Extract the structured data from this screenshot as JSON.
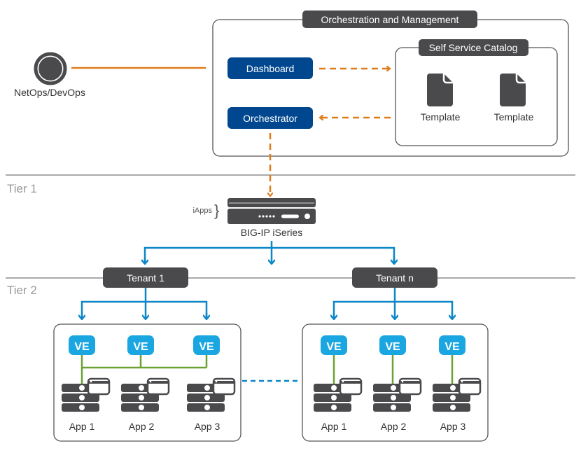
{
  "actor": {
    "label": "NetOps/DevOps",
    "icon": "user-icon"
  },
  "orchestration": {
    "title": "Orchestration and Management",
    "dashboard_label": "Dashboard",
    "orchestrator_label": "Orchestrator",
    "catalog": {
      "title": "Self Service Catalog",
      "templates": [
        {
          "label": "Template",
          "icon": "document-icon"
        },
        {
          "label": "Template",
          "icon": "document-icon"
        }
      ]
    }
  },
  "tiers": {
    "tier1": "Tier 1",
    "tier2": "Tier 2"
  },
  "device": {
    "label": "BIG-IP iSeries",
    "iapps_label": "iApps"
  },
  "tenants": [
    {
      "label": "Tenant 1",
      "ve_label": "VE",
      "apps": [
        "App 1",
        "App 2",
        "App 3"
      ],
      "ve_wiring": "shared"
    },
    {
      "label": "Tenant n",
      "ve_label": "VE",
      "apps": [
        "App 1",
        "App 2",
        "App 3"
      ],
      "ve_wiring": "individual"
    }
  ],
  "colors": {
    "orange": "#e07b1a",
    "blue": "#0b86c8",
    "navy": "#00478f",
    "dark": "#4a4a4d",
    "green": "#6aa233",
    "ve": "#1aa6e0"
  }
}
